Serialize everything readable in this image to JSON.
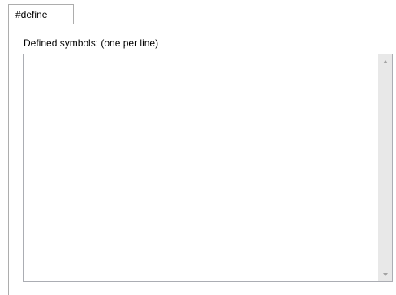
{
  "tabs": [
    {
      "label": "#define",
      "selected": true
    }
  ],
  "defines": {
    "label": "Defined symbols:  (one per line)",
    "value": ""
  },
  "icons": {
    "scroll_up": "scroll-up-arrow",
    "scroll_down": "scroll-down-arrow"
  },
  "colors": {
    "border": "#adadad",
    "scrollbar_track": "#e8e8e8",
    "scroll_arrow": "#a3a3a3"
  }
}
